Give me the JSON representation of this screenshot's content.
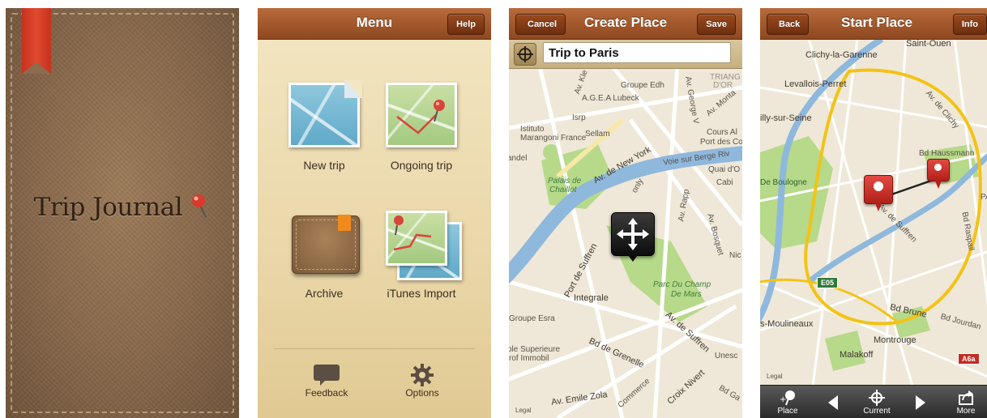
{
  "cover": {
    "title": "Trip Journal"
  },
  "menu_screen": {
    "title": "Menu",
    "help_label": "Help",
    "items": [
      {
        "label": "New trip"
      },
      {
        "label": "Ongoing trip"
      },
      {
        "label": "Archive"
      },
      {
        "label": "iTunes Import"
      }
    ],
    "footer": {
      "feedback_label": "Feedback",
      "options_label": "Options"
    }
  },
  "create_place": {
    "title": "Create Place",
    "cancel_label": "Cancel",
    "save_label": "Save",
    "name_value": "Trip to Paris",
    "map_labels": {
      "groupe": "Groupe Edh",
      "ageal": "A.G.E.A Lubeck",
      "isrp": "Isrp",
      "istituto": "Istituto",
      "marangoni": "Marangoni France",
      "sellam": "Sellam",
      "triang": "TRIANG",
      "dor": "D'OR",
      "avkle": "Av. Kle",
      "george": "Av. George V",
      "avmont": "Av. Monta",
      "cours": "Cours Al",
      "port": "Port des Co",
      "landel": "andel",
      "newyork": "Av. de New York",
      "voie": "Voie sur Berge Riv",
      "quai": "Quai d'O",
      "cabi": "Cabi",
      "palais": "Palais de",
      "chaillot": "Chaillot",
      "suffren": "Port de Suffren",
      "rapp": "Av. Rapp",
      "bosquet": "Av. Bosquet",
      "champ1": "Parc Du Champ",
      "champ2": "De Mars",
      "integrale": "Integrale",
      "groupe2": "Groupe Esra",
      "grenelle": "Bd de Grenelle",
      "suffren2": "Av. de Suffren",
      "superieure": "ole Superieure",
      "immobil": "rof Immobil",
      "emile": "Av. Emile Zola",
      "commerce": "Commerce",
      "croix": "Croix Nivert",
      "unesco": "Unesc",
      "bdga": "Bd Ga",
      "nic": "Nic",
      "only": "only",
      "legal": "Legal"
    }
  },
  "start_place": {
    "title": "Start Place",
    "back_label": "Back",
    "info_label": "Info",
    "map_labels": {
      "saintouen": "Saint-Ouen",
      "clichy": "Clichy-la-Garenne",
      "levallois": "Levallois-Perret",
      "neuilly": "illy-sur-Seine",
      "boulogne": "De Boulogne",
      "haussmann": "Bd Haussmann",
      "clichyav": "Av. de Clichy",
      "suffren": "Av. de Suffren",
      "raspail": "Bd Raspail",
      "moulineaux": "s-Moulineaux",
      "montrouge": "Montrouge",
      "malakoff": "Malakoff",
      "bdbrune": "Bd Brune",
      "bdjourdan": "Bd Jourdan",
      "pa": "PA",
      "e05": "E05",
      "a6a": "A6a",
      "legal": "Legal"
    },
    "toolbar": {
      "place_label": "Place",
      "current_label": "Current",
      "more_label": "More"
    }
  }
}
